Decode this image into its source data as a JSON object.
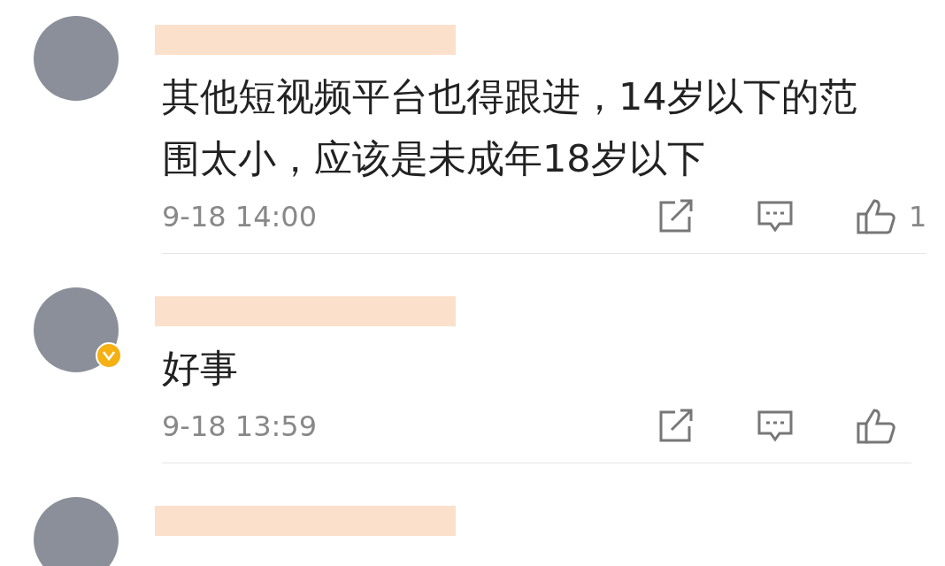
{
  "comments": [
    {
      "verified": false,
      "text": "其他短视频平台也得跟进，14岁以下的范围太小，应该是未成年18岁以下",
      "time": "9-18 14:00",
      "likes": "1"
    },
    {
      "verified": true,
      "text": "好事",
      "time": "9-18 13:59"
    },
    {
      "verified": false
    }
  ]
}
